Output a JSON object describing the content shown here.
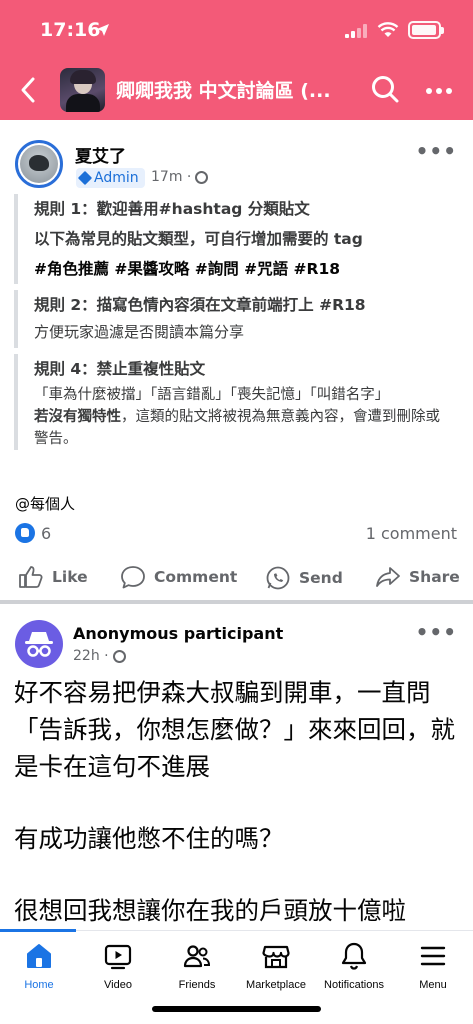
{
  "status_bar": {
    "time": "17:16"
  },
  "header": {
    "title": "卿卿我我 中文討論區 (..."
  },
  "post1": {
    "author": "夏艾了",
    "badge": "Admin",
    "time": "17m ·",
    "rules": [
      {
        "heading": "規則 1：歡迎善用#hashtag 分類貼文",
        "sub": "以下為常見的貼文類型，可自行增加需要的 tag",
        "tags": "#角色推薦 #果醬攻略 #詢問 #咒語 #R18"
      },
      {
        "heading": "規則 2：描寫色情內容須在文章前端打上 #R18",
        "body": "方便玩家過濾是否閱讀本篇分享"
      },
      {
        "heading": "規則 4：禁止重複性貼文",
        "body_plain": "「車為什麼被擋」「語言錯亂」「喪失記憶」「叫錯名字」",
        "body_bold": "若沒有獨特性",
        "body_tail": "，這類的貼文將被視為無意義內容，會遭到刪除或警告。"
      }
    ],
    "mention": "@每個人",
    "like_count": "6",
    "comment_count": "1 comment",
    "actions": {
      "like": "Like",
      "comment": "Comment",
      "send": "Send",
      "share": "Share"
    }
  },
  "post2": {
    "author": "Anonymous participant",
    "time": "22h ·",
    "paragraphs": [
      "好不容易把伊森大叔騙到開車，一直問「告訴我，你想怎麼做？」來來回回，就是卡在這句不進展",
      "有成功讓他憋不住的嗎？",
      "很想回我想讓你在我的戶頭放十億啦"
    ]
  },
  "tabbar": {
    "items": [
      {
        "label": "Home",
        "icon": "home-icon"
      },
      {
        "label": "Video",
        "icon": "video-icon"
      },
      {
        "label": "Friends",
        "icon": "friends-icon"
      },
      {
        "label": "Marketplace",
        "icon": "marketplace-icon"
      },
      {
        "label": "Notifications",
        "icon": "bell-icon"
      },
      {
        "label": "Menu",
        "icon": "hamburger-icon"
      }
    ]
  },
  "colors": {
    "header": "#f35a78",
    "accent": "#1b74e4"
  }
}
